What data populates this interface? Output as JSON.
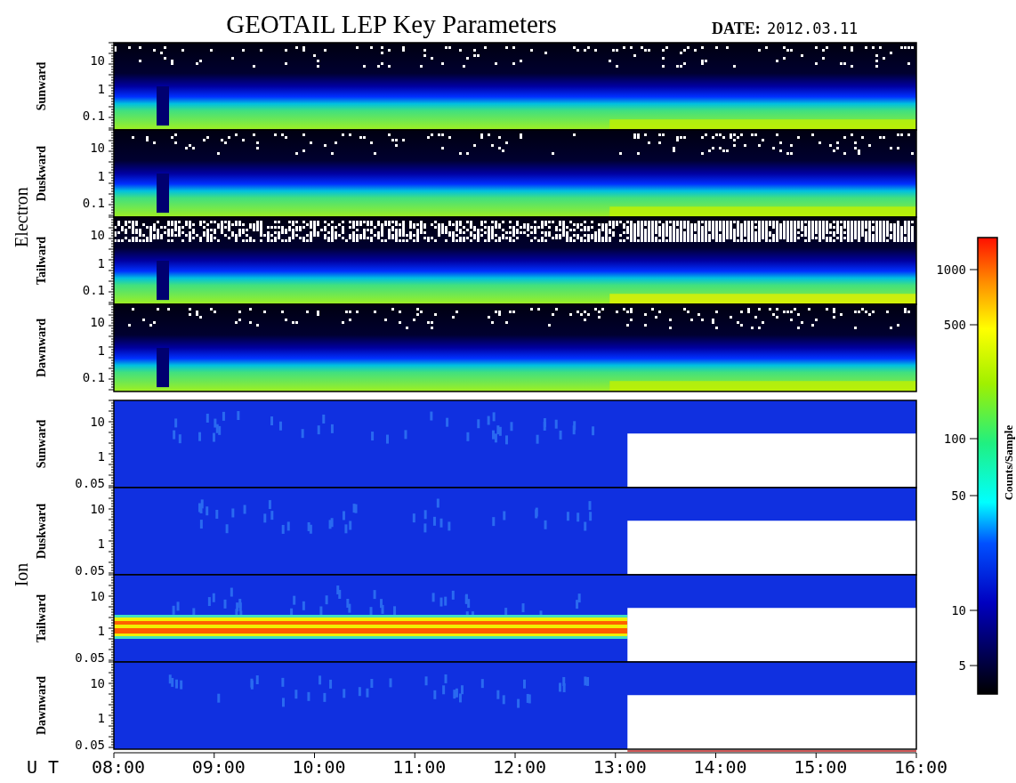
{
  "title": "GEOTAIL LEP Key Parameters",
  "date_label": "DATE:",
  "date": "2012.03.11",
  "groups": [
    {
      "species": "Electron",
      "kind": "electron",
      "panels": [
        {
          "direction": "Sunward",
          "kind": "sparse",
          "yticks": [
            "10",
            "1",
            "0.1"
          ]
        },
        {
          "direction": "Duskward",
          "kind": "sparse",
          "yticks": [
            "10",
            "1",
            "0.1"
          ]
        },
        {
          "direction": "Tailward",
          "kind": "dense",
          "yticks": [
            "10",
            "1",
            "0.1"
          ]
        },
        {
          "direction": "Dawnward",
          "kind": "sparse",
          "yticks": [
            "10",
            "1",
            "0.1"
          ]
        }
      ]
    },
    {
      "species": "Ion",
      "kind": "ion",
      "panels": [
        {
          "direction": "Sunward",
          "kind": "quiet",
          "yticks": [
            "10",
            "1",
            "0.05"
          ]
        },
        {
          "direction": "Duskward",
          "kind": "quiet",
          "yticks": [
            "10",
            "1",
            "0.05"
          ]
        },
        {
          "direction": "Tailward",
          "kind": "beam",
          "yticks": [
            "10",
            "1",
            "0.05"
          ]
        },
        {
          "direction": "Dawnward",
          "kind": "quiet",
          "yticks": [
            "10",
            "1",
            "0.05"
          ]
        }
      ]
    }
  ],
  "colorbar": {
    "label": "Counts/Sample",
    "ticks": [
      "1000",
      "500",
      "100",
      "50",
      "10",
      "5"
    ]
  },
  "time_axis": {
    "label": "U T",
    "ticks": [
      "08:00",
      "09:00",
      "10:00",
      "11:00",
      "12:00",
      "13:00",
      "14:00",
      "15:00",
      "16:00"
    ]
  }
}
